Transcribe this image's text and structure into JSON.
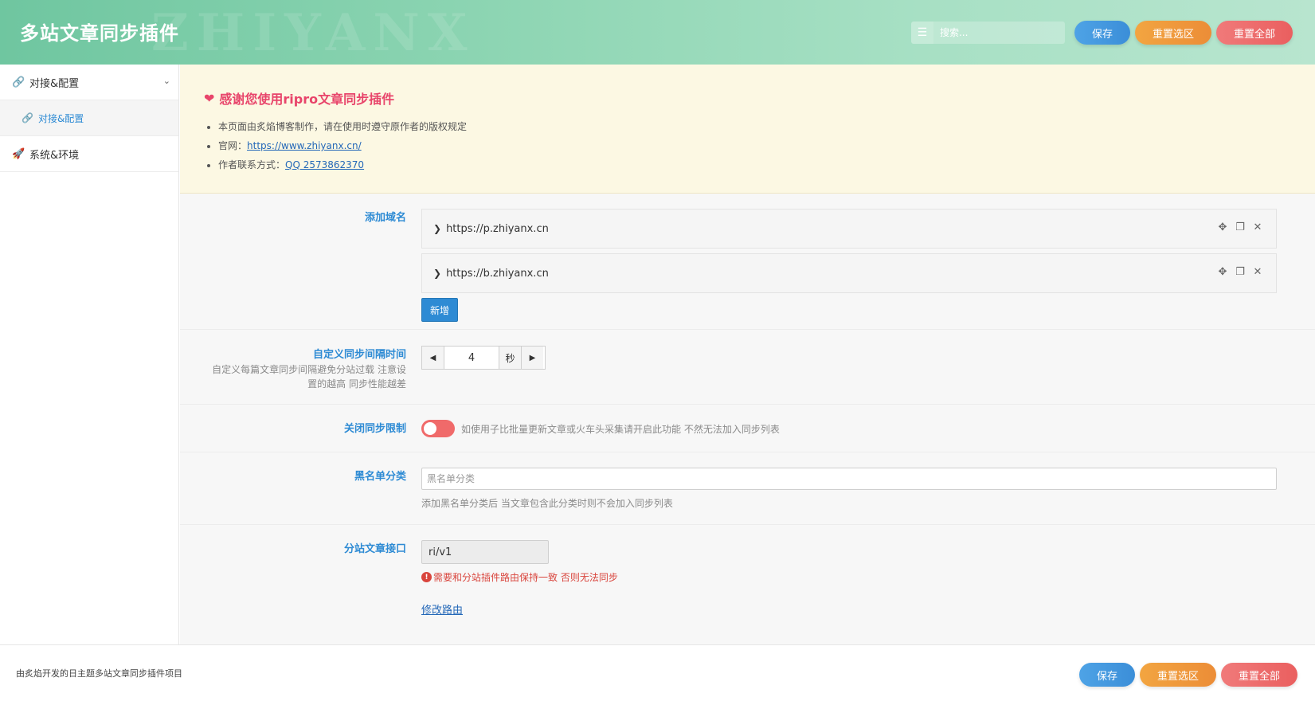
{
  "header": {
    "title": "多站文章同步插件",
    "search_placeholder": "搜索...",
    "save_label": "保存",
    "reset_section_label": "重置选区",
    "reset_all_label": "重置全部"
  },
  "sidebar": {
    "items": [
      {
        "label": "对接&配置",
        "icon": "link-icon",
        "expanded": true,
        "children": [
          {
            "label": "对接&配置",
            "icon": "link-icon"
          }
        ]
      },
      {
        "label": "系统&环境",
        "icon": "rocket-icon"
      }
    ]
  },
  "notice": {
    "title": "感谢您使用ripro文章同步插件",
    "line1": "本页面由炙焰博客制作，请在使用时遵守原作者的版权规定",
    "line2_prefix": "官网：",
    "line2_link": "https://www.zhiyanx.cn/",
    "line3_prefix": "作者联系方式：",
    "line3_link": "QQ 2573862370"
  },
  "fields": {
    "domains": {
      "label": "添加域名",
      "items": [
        "https://p.zhiyanx.cn",
        "https://b.zhiyanx.cn"
      ],
      "add_label": "新增"
    },
    "interval": {
      "label": "自定义同步间隔时间",
      "desc": "自定义每篇文章同步间隔避免分站过载 注意设置的越高 同步性能越差",
      "value": "4",
      "unit": "秒"
    },
    "limit": {
      "label": "关闭同步限制",
      "enabled": false,
      "hint": "如使用子比批量更新文章或火车头采集请开启此功能 不然无法加入同步列表"
    },
    "blacklist": {
      "label": "黑名单分类",
      "placeholder": "黑名单分类",
      "hint": "添加黑名单分类后 当文章包含此分类时则不会加入同步列表"
    },
    "api": {
      "label": "分站文章接口",
      "value": "ri/v1",
      "error": "需要和分站插件路由保持一致 否则无法同步",
      "link": "修改路由"
    }
  },
  "footer": {
    "text": "由炙焰开发的日主题多站文章同步插件项目",
    "save_label": "保存",
    "reset_section_label": "重置选区",
    "reset_all_label": "重置全部"
  },
  "colors": {
    "accent": "#2e8bd4",
    "header_green": "#8fd6b4",
    "notice_bg": "#fcf8e3",
    "error": "#d9453d",
    "toggle_off": "#f06a6a"
  }
}
